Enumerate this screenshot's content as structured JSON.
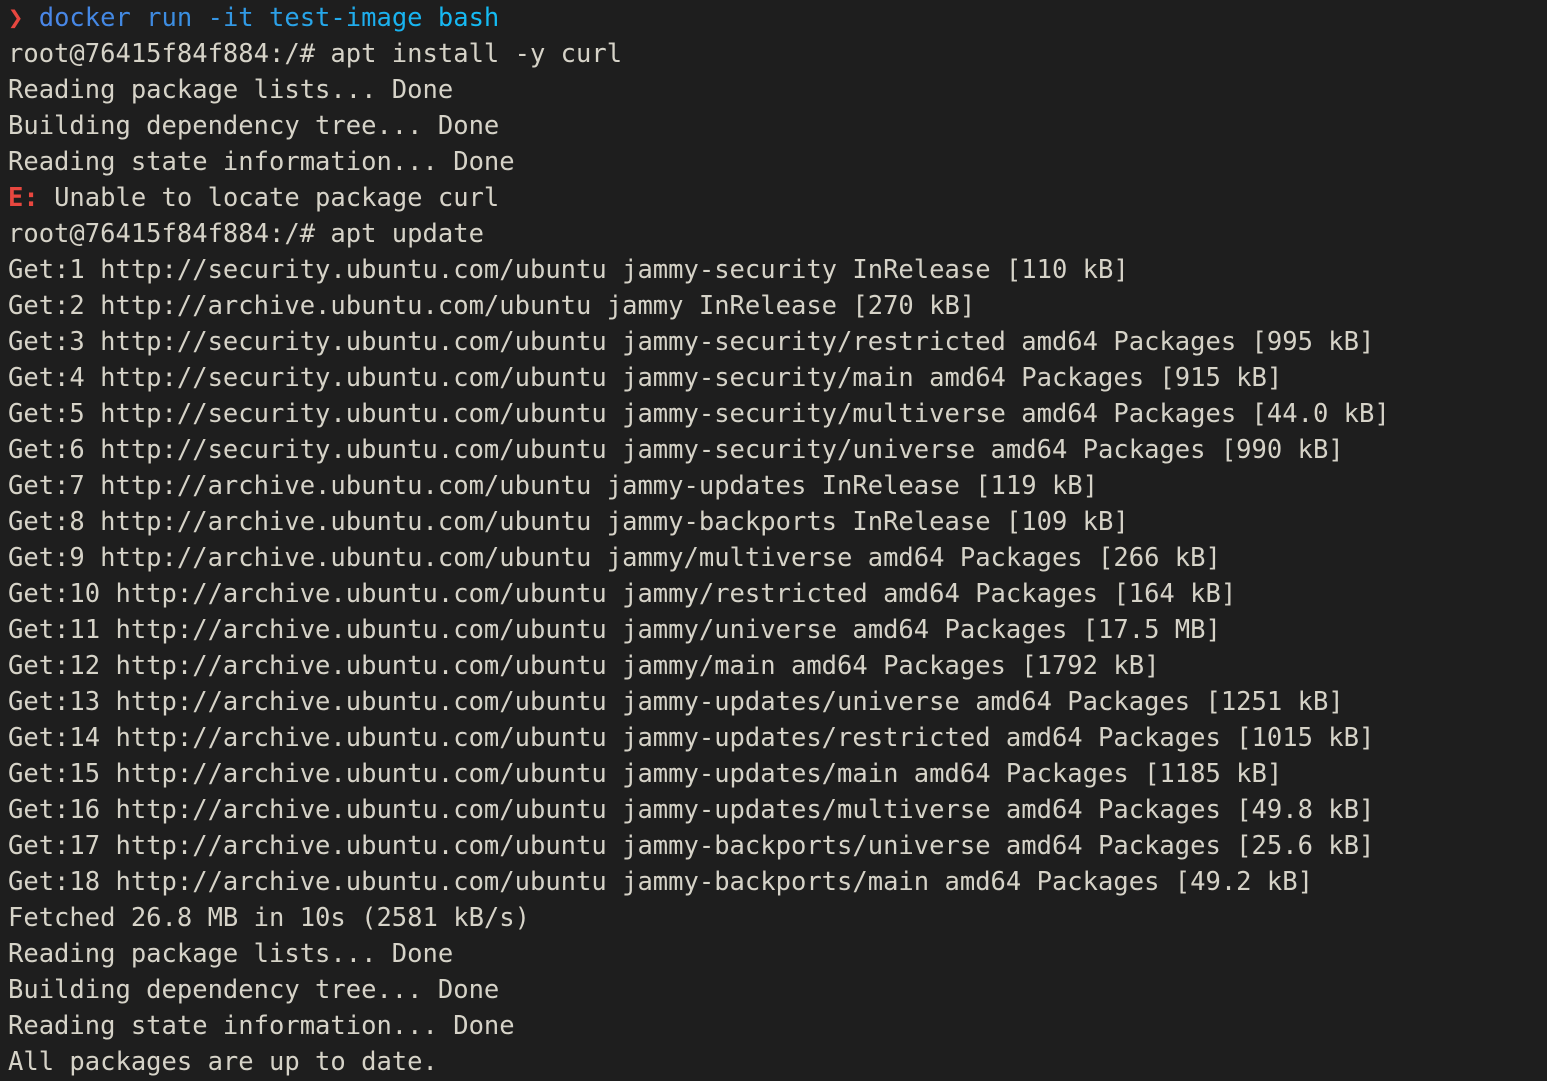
{
  "terminal": {
    "background_color": "#1e1e1e",
    "foreground_color": "#d6d3c8",
    "prompt_symbol": "❯",
    "prompt_symbol_color": "#e8473f",
    "command_color_start": "#4a86e8",
    "command_color_end": "#14bdf5",
    "error_color": "#e8473f",
    "shell_prompt": "root@76415f84f884:/#",
    "container_id": "76415f84f884"
  },
  "lines": [
    {
      "type": "prompt-command",
      "prompt": "❯",
      "command": "docker run -it test-image bash"
    },
    {
      "type": "shell-input",
      "prompt": "root@76415f84f884:/#",
      "command": " apt install -y curl"
    },
    {
      "type": "output",
      "text": "Reading package lists... Done"
    },
    {
      "type": "output",
      "text": "Building dependency tree... Done"
    },
    {
      "type": "output",
      "text": "Reading state information... Done"
    },
    {
      "type": "error",
      "prefix": "E:",
      "text": " Unable to locate package curl"
    },
    {
      "type": "shell-input",
      "prompt": "root@76415f84f884:/#",
      "command": " apt update"
    },
    {
      "type": "output",
      "text": "Get:1 http://security.ubuntu.com/ubuntu jammy-security InRelease [110 kB]"
    },
    {
      "type": "output",
      "text": "Get:2 http://archive.ubuntu.com/ubuntu jammy InRelease [270 kB]"
    },
    {
      "type": "output",
      "text": "Get:3 http://security.ubuntu.com/ubuntu jammy-security/restricted amd64 Packages [995 kB]"
    },
    {
      "type": "output",
      "text": "Get:4 http://security.ubuntu.com/ubuntu jammy-security/main amd64 Packages [915 kB]"
    },
    {
      "type": "output",
      "text": "Get:5 http://security.ubuntu.com/ubuntu jammy-security/multiverse amd64 Packages [44.0 kB]"
    },
    {
      "type": "output",
      "text": "Get:6 http://security.ubuntu.com/ubuntu jammy-security/universe amd64 Packages [990 kB]"
    },
    {
      "type": "output",
      "text": "Get:7 http://archive.ubuntu.com/ubuntu jammy-updates InRelease [119 kB]"
    },
    {
      "type": "output",
      "text": "Get:8 http://archive.ubuntu.com/ubuntu jammy-backports InRelease [109 kB]"
    },
    {
      "type": "output",
      "text": "Get:9 http://archive.ubuntu.com/ubuntu jammy/multiverse amd64 Packages [266 kB]"
    },
    {
      "type": "output",
      "text": "Get:10 http://archive.ubuntu.com/ubuntu jammy/restricted amd64 Packages [164 kB]"
    },
    {
      "type": "output",
      "text": "Get:11 http://archive.ubuntu.com/ubuntu jammy/universe amd64 Packages [17.5 MB]"
    },
    {
      "type": "output",
      "text": "Get:12 http://archive.ubuntu.com/ubuntu jammy/main amd64 Packages [1792 kB]"
    },
    {
      "type": "output",
      "text": "Get:13 http://archive.ubuntu.com/ubuntu jammy-updates/universe amd64 Packages [1251 kB]"
    },
    {
      "type": "output",
      "text": "Get:14 http://archive.ubuntu.com/ubuntu jammy-updates/restricted amd64 Packages [1015 kB]"
    },
    {
      "type": "output",
      "text": "Get:15 http://archive.ubuntu.com/ubuntu jammy-updates/main amd64 Packages [1185 kB]"
    },
    {
      "type": "output",
      "text": "Get:16 http://archive.ubuntu.com/ubuntu jammy-updates/multiverse amd64 Packages [49.8 kB]"
    },
    {
      "type": "output",
      "text": "Get:17 http://archive.ubuntu.com/ubuntu jammy-backports/universe amd64 Packages [25.6 kB]"
    },
    {
      "type": "output",
      "text": "Get:18 http://archive.ubuntu.com/ubuntu jammy-backports/main amd64 Packages [49.2 kB]"
    },
    {
      "type": "output",
      "text": "Fetched 26.8 MB in 10s (2581 kB/s)"
    },
    {
      "type": "output",
      "text": "Reading package lists... Done"
    },
    {
      "type": "output",
      "text": "Building dependency tree... Done"
    },
    {
      "type": "output",
      "text": "Reading state information... Done"
    },
    {
      "type": "output",
      "text": "All packages are up to date."
    }
  ]
}
